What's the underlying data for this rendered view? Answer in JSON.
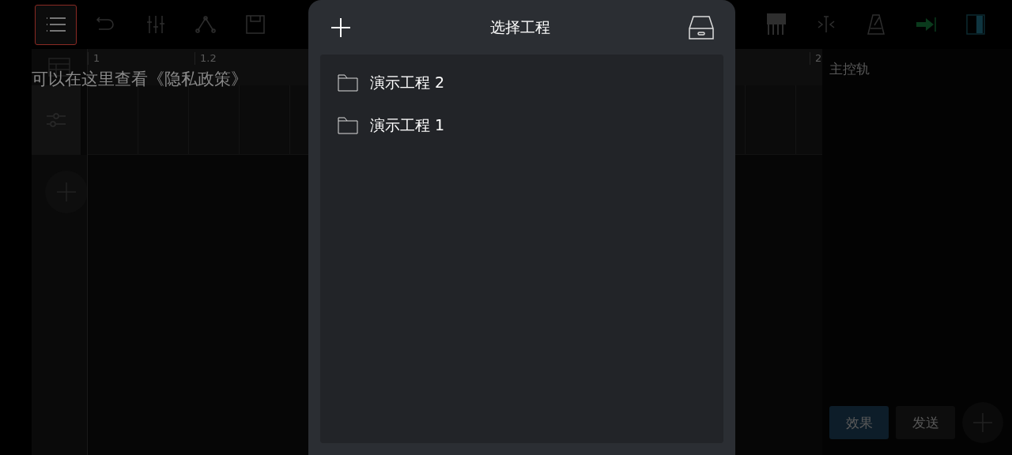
{
  "menu_button": {
    "selected": true
  },
  "ruler": {
    "marks": [
      "1",
      "1.2",
      "2"
    ]
  },
  "hint": "可以在这里查看《隐私政策》",
  "dialog": {
    "title": "选择工程",
    "projects": [
      {
        "name": "演示工程 2"
      },
      {
        "name": "演示工程 1"
      }
    ]
  },
  "master_panel": {
    "title": "主控轨",
    "tabs": [
      {
        "label": "效果",
        "selected": true
      },
      {
        "label": "发送",
        "selected": false
      }
    ]
  }
}
